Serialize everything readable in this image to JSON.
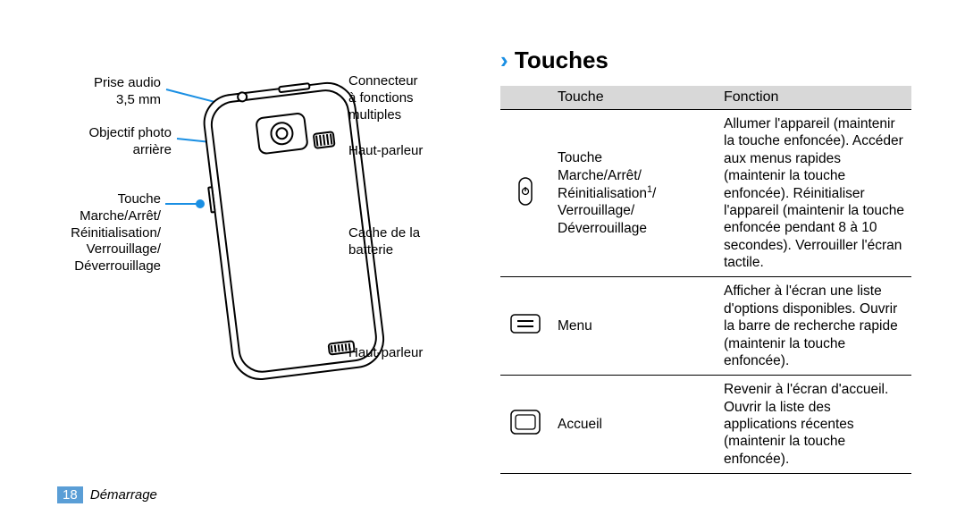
{
  "section_title": "Touches",
  "diagram": {
    "labels_left": [
      {
        "text": "Prise audio\n3,5 mm"
      },
      {
        "text": "Objectif photo\narrière"
      },
      {
        "text": "Touche\nMarche/Arrêt/\nRéinitialisation/\nVerrouillage/\nDéverrouillage"
      }
    ],
    "labels_right": [
      {
        "text": "Connecteur\nà fonctions\nmultiples"
      },
      {
        "text": "Haut-parleur"
      },
      {
        "text": "Cache de la\nbatterie"
      },
      {
        "text": "Haut-parleur"
      }
    ]
  },
  "table": {
    "headers": [
      "",
      "Touche",
      "Fonction"
    ],
    "rows": [
      {
        "icon": "power-icon",
        "key": "Touche\nMarche/Arrêt/\nRéinitialisation¹/\nVerrouillage/\nDéverrouillage",
        "fn": "Allumer l'appareil (maintenir la touche enfoncée). Accéder aux menus rapides (maintenir la touche enfoncée). Réinitialiser l'appareil (maintenir la touche enfoncée pendant 8 à 10 secondes). Verrouiller l'écran tactile."
      },
      {
        "icon": "menu-icon",
        "key": "Menu",
        "fn": "Afficher à l'écran une liste d'options disponibles. Ouvrir la barre de recherche rapide (maintenir la touche enfoncée)."
      },
      {
        "icon": "home-icon",
        "key": "Accueil",
        "fn": "Revenir à l'écran d'accueil. Ouvrir la liste des applications récentes (maintenir la touche enfoncée)."
      }
    ]
  },
  "footer": {
    "page": "18",
    "section": "Démarrage"
  }
}
